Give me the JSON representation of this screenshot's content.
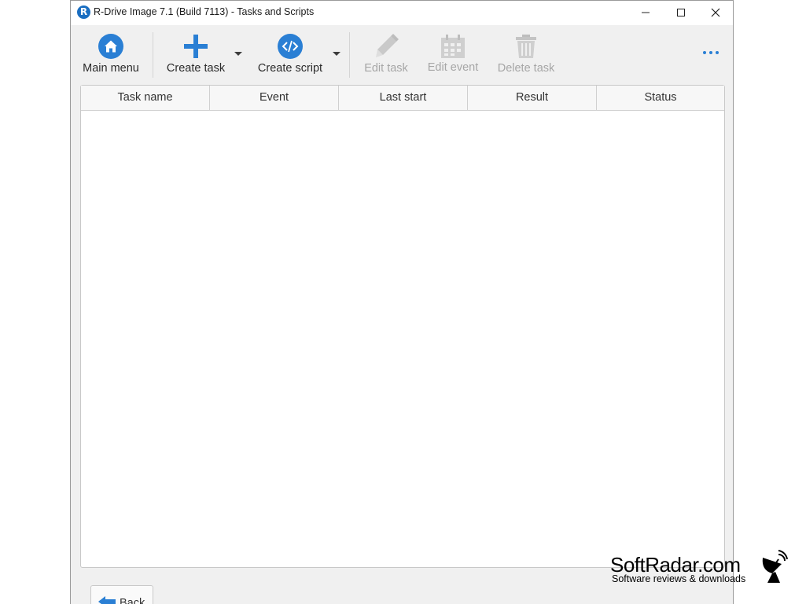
{
  "window": {
    "title": "R-Drive Image 7.1 (Build 7113) - Tasks and Scripts",
    "logo_letter": "R"
  },
  "toolbar": {
    "main_menu": "Main menu",
    "create_task": "Create task",
    "create_script": "Create script",
    "edit_task": "Edit task",
    "edit_event": "Edit event",
    "delete_task": "Delete task"
  },
  "table": {
    "columns": [
      "Task name",
      "Event",
      "Last start",
      "Result",
      "Status"
    ],
    "rows": []
  },
  "footer": {
    "back_label": "Back"
  },
  "watermark": {
    "name": "SoftRadar.com",
    "tagline": "Software reviews & downloads"
  },
  "colors": {
    "accent": "#2a7fd4",
    "disabled": "#a6a6a6"
  }
}
